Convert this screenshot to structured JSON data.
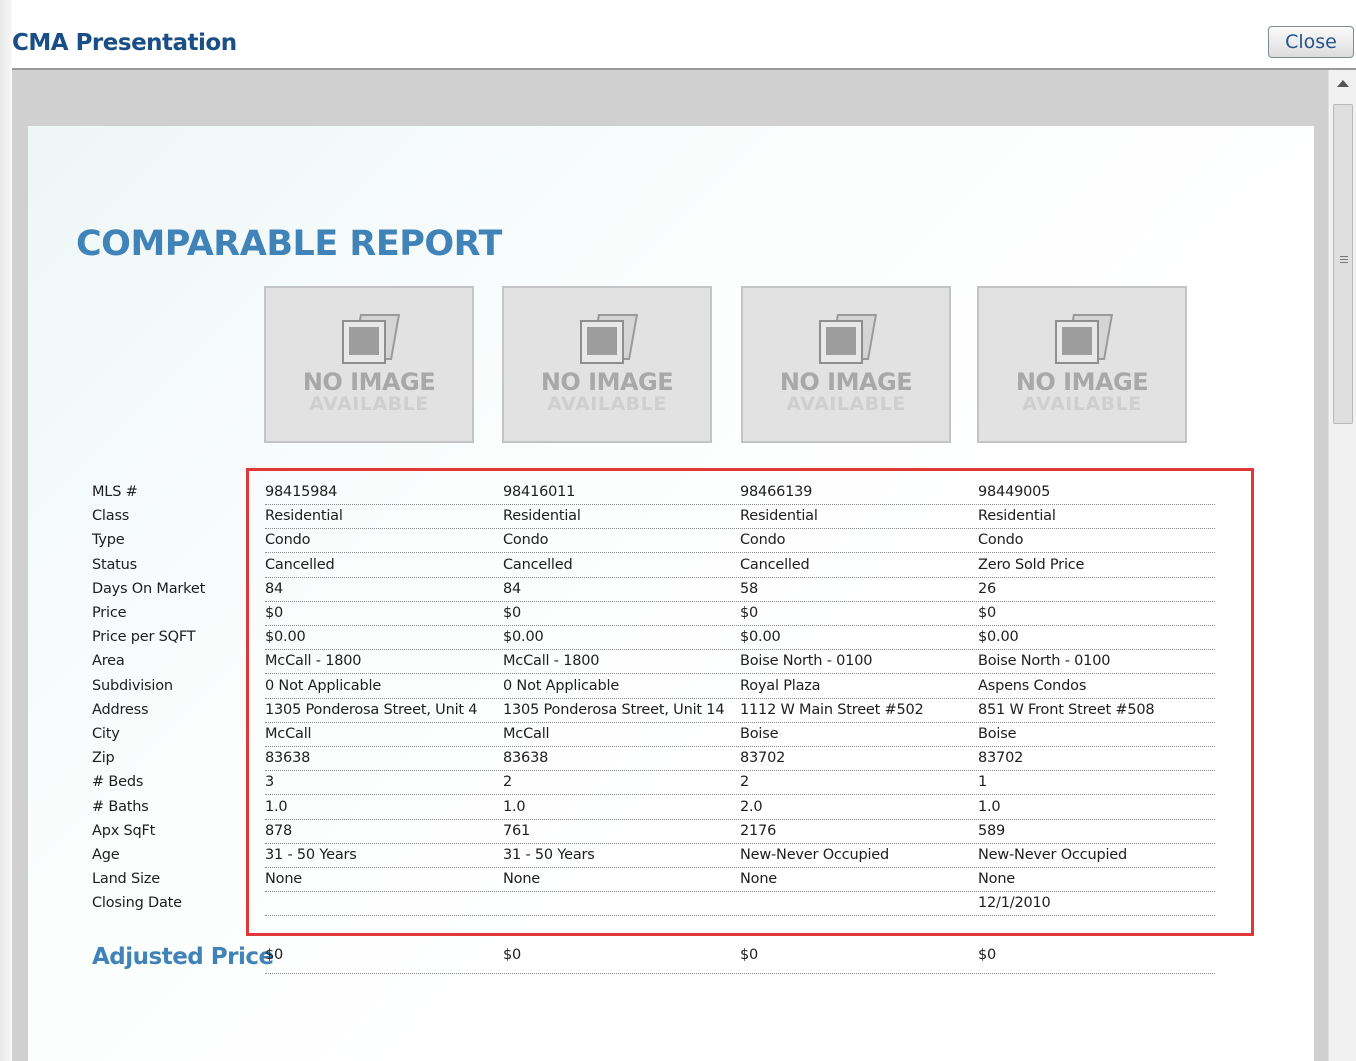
{
  "window": {
    "title": "CMA Presentation",
    "close_label": "Close"
  },
  "report": {
    "title": "COMPARABLE REPORT",
    "photo_placeholder": {
      "line1": "NO IMAGE",
      "line2": "AVAILABLE",
      "icon": "photo-placeholder-icon"
    },
    "row_labels": [
      "MLS #",
      "Class",
      "Type",
      "Status",
      "Days On Market",
      "Price",
      "Price per SQFT",
      "Area",
      "Subdivision",
      "Address",
      "City",
      "Zip",
      "# Beds",
      "# Baths",
      "Apx SqFt",
      "Age",
      "Land Size",
      "Closing Date"
    ],
    "columns": [
      [
        "98415984",
        "Residential",
        "Condo",
        "Cancelled",
        "84",
        "$0",
        "$0.00",
        "McCall - 1800",
        "0 Not Applicable",
        "1305 Ponderosa Street, Unit 4",
        "McCall",
        "83638",
        "3",
        "1.0",
        "878",
        "31 - 50 Years",
        "None",
        ""
      ],
      [
        "98416011",
        "Residential",
        "Condo",
        "Cancelled",
        "84",
        "$0",
        "$0.00",
        "McCall - 1800",
        "0 Not Applicable",
        "1305 Ponderosa Street, Unit 14",
        "McCall",
        "83638",
        "2",
        "1.0",
        "761",
        "31 - 50 Years",
        "None",
        ""
      ],
      [
        "98466139",
        "Residential",
        "Condo",
        "Cancelled",
        "58",
        "$0",
        "$0.00",
        "Boise North - 0100",
        "Royal Plaza",
        "1112 W Main Street #502",
        "Boise",
        "83702",
        "2",
        "2.0",
        "2176",
        "New-Never Occupied",
        "None",
        ""
      ],
      [
        "98449005",
        "Residential",
        "Condo",
        "Zero Sold Price",
        "26",
        "$0",
        "$0.00",
        "Boise North - 0100",
        "Aspens Condos",
        "851 W Front Street #508",
        "Boise",
        "83702",
        "1",
        "1.0",
        "589",
        "New-Never Occupied",
        "None",
        "12/1/2010"
      ]
    ],
    "adjusted_price": {
      "label": "Adjusted Price",
      "values": [
        "$0",
        "$0",
        "$0",
        "$0"
      ]
    }
  },
  "colors": {
    "title_blue": "#1a4e86",
    "report_blue": "#3f83b8",
    "highlight_red": "#e0373b"
  }
}
